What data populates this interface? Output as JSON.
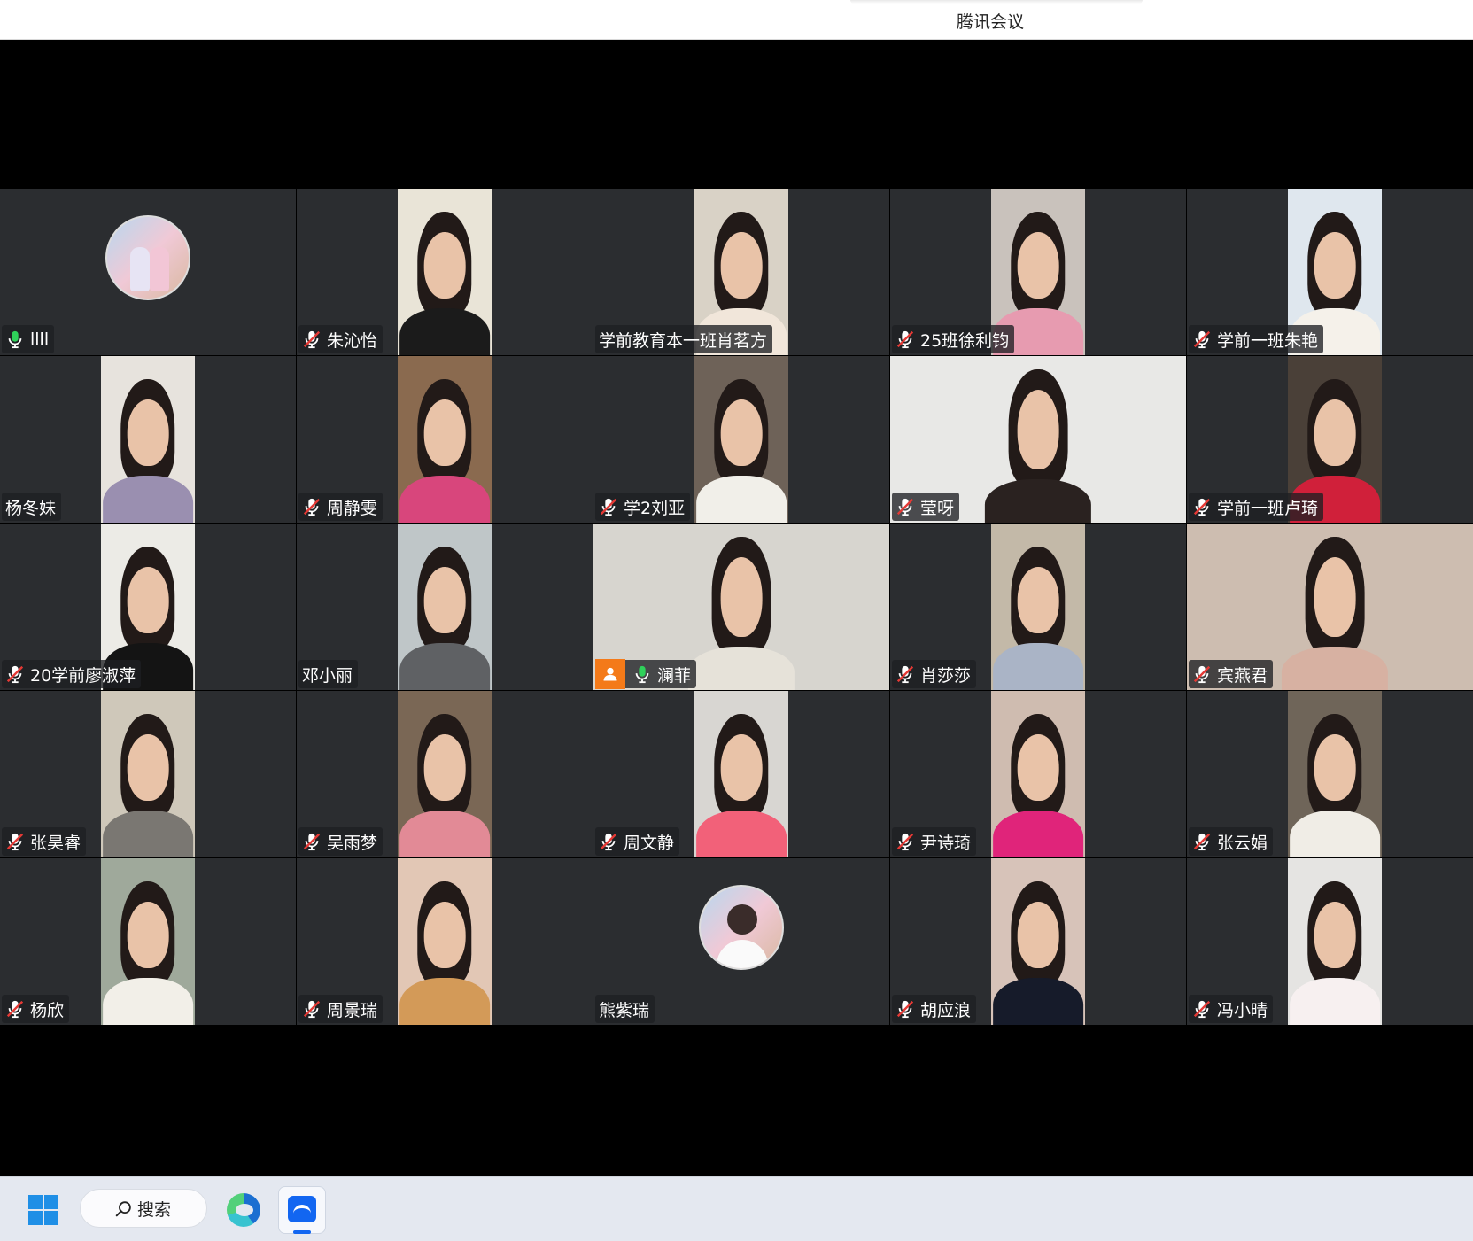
{
  "window": {
    "title": "腾讯会议"
  },
  "colors": {
    "tile_bg": "#2b2d30",
    "host_badge": "#f47a19",
    "mic_on": "#2fd05a",
    "mic_muted": "#e53935"
  },
  "participants": [
    {
      "name": "llll",
      "mic": "on",
      "video": "avatar"
    },
    {
      "name": "朱沁怡",
      "mic": "muted",
      "video": "camera",
      "bg": "#e9e4d7",
      "shirt": "#1b1b1b"
    },
    {
      "name": "学前教育本一班肖茗方",
      "mic": "none",
      "video": "camera",
      "bg": "#d9d2c6",
      "shirt": "#f1e6da"
    },
    {
      "name": "25班徐利钧",
      "mic": "muted",
      "video": "camera",
      "bg": "#c9c2bc",
      "shirt": "#e79bb0"
    },
    {
      "name": "学前一班朱艳",
      "mic": "muted",
      "video": "camera",
      "bg": "#dfe7ee",
      "shirt": "#f5f1ea"
    },
    {
      "name": "杨冬妹",
      "mic": "none",
      "video": "camera",
      "bg": "#e7e3dd",
      "shirt": "#9a8fb0"
    },
    {
      "name": "周静雯",
      "mic": "muted",
      "video": "camera",
      "bg": "#8a6a4f",
      "shirt": "#d8467c"
    },
    {
      "name": "学2刘亚",
      "mic": "muted",
      "video": "camera",
      "bg": "#6e6258",
      "shirt": "#f1efe9"
    },
    {
      "name": "莹呀",
      "mic": "muted",
      "video": "wide",
      "bg": "#e8e8e6",
      "shirt": "#2a2220"
    },
    {
      "name": "学前一班卢琦",
      "mic": "muted",
      "video": "camera",
      "bg": "#4a4038",
      "shirt": "#d0203a"
    },
    {
      "name": "20学前廖淑萍",
      "mic": "muted",
      "video": "camera",
      "bg": "#ecebe6",
      "shirt": "#141414"
    },
    {
      "name": "邓小丽",
      "mic": "none",
      "video": "camera",
      "bg": "#bfc6c8",
      "shirt": "#5f6164"
    },
    {
      "name": "澜菲",
      "mic": "on",
      "video": "wide",
      "host": true,
      "bg": "#d7d5cf",
      "shirt": "#e6e2d9"
    },
    {
      "name": "肖莎莎",
      "mic": "muted",
      "video": "camera",
      "bg": "#c3b9a8",
      "shirt": "#aab4c6"
    },
    {
      "name": "宾燕君",
      "mic": "muted",
      "video": "wide",
      "bg": "#cdbdb0",
      "shirt": "#d7b1a2"
    },
    {
      "name": "张昊睿",
      "mic": "muted",
      "video": "camera",
      "bg": "#cfc8ba",
      "shirt": "#7a7772"
    },
    {
      "name": "吴雨梦",
      "mic": "muted",
      "video": "camera",
      "bg": "#7a6755",
      "shirt": "#e28a96"
    },
    {
      "name": "周文静",
      "mic": "muted",
      "video": "camera",
      "bg": "#d8d6d2",
      "shirt": "#f26179"
    },
    {
      "name": "尹诗琦",
      "mic": "muted",
      "video": "camera",
      "bg": "#cfbcb0",
      "shirt": "#e0247a"
    },
    {
      "name": "张云娟",
      "mic": "muted",
      "video": "camera",
      "bg": "#6f6559",
      "shirt": "#f0ede6"
    },
    {
      "name": "杨欣",
      "mic": "muted",
      "video": "camera",
      "bg": "#9fa99b",
      "shirt": "#f2efe8"
    },
    {
      "name": "周景瑞",
      "mic": "muted",
      "video": "camera",
      "bg": "#e2c7b5",
      "shirt": "#d39a58"
    },
    {
      "name": "熊紫瑞",
      "mic": "none",
      "video": "avatar2"
    },
    {
      "name": "胡应浪",
      "mic": "muted",
      "video": "camera",
      "bg": "#d7c3b9",
      "shirt": "#161b2a"
    },
    {
      "name": "冯小晴",
      "mic": "muted",
      "video": "camera",
      "bg": "#e5e4e2",
      "shirt": "#f7f0f0"
    }
  ],
  "taskbar": {
    "search_label": "搜索",
    "icons": [
      "windows-start-icon",
      "search-icon",
      "edge-browser-icon",
      "tencent-meeting-icon"
    ]
  }
}
